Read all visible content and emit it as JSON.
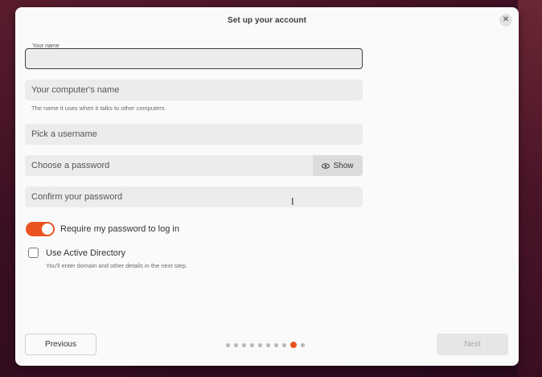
{
  "dialog": {
    "title": "Set up your account",
    "close_icon": "close-icon"
  },
  "form": {
    "name_label": "Your name",
    "name_value": "",
    "computer_placeholder": "Your computer's name",
    "computer_hint": "The name it uses when it talks to other computers.",
    "username_placeholder": "Pick a username",
    "password_placeholder": "Choose a password",
    "show_label": "Show",
    "confirm_placeholder": "Confirm your password",
    "require_password_label": "Require my password to log in",
    "require_password_on": true,
    "active_directory_label": "Use Active Directory",
    "active_directory_checked": false,
    "active_directory_hint": "You'll enter domain and other details in the next step."
  },
  "footer": {
    "previous_label": "Previous",
    "next_label": "Next",
    "step_count": 10,
    "current_step": 9
  },
  "colors": {
    "accent": "#e95420"
  }
}
